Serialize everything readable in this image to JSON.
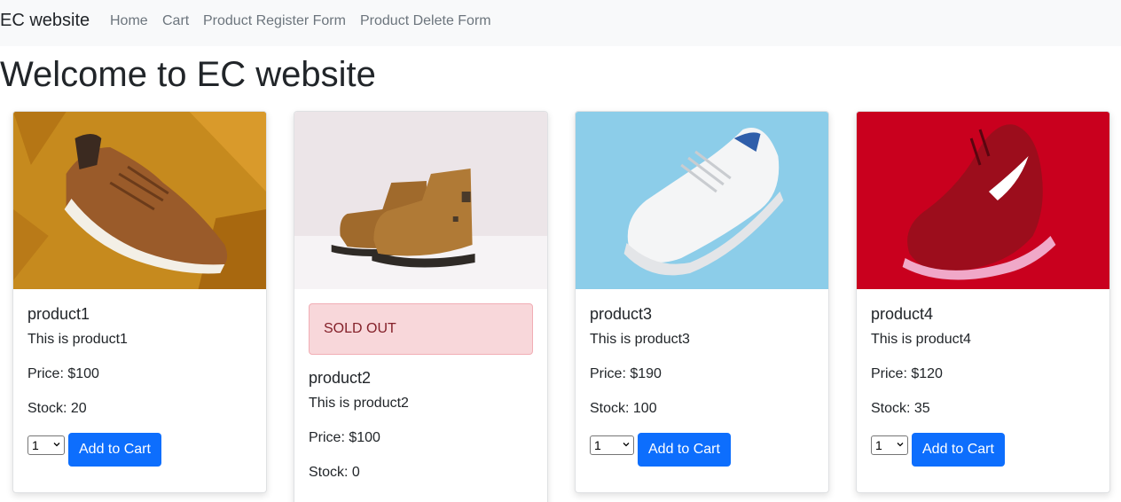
{
  "nav": {
    "brand": "EC website",
    "links": [
      "Home",
      "Cart",
      "Product Register Form",
      "Product Delete Form"
    ]
  },
  "page": {
    "title": "Welcome to EC website"
  },
  "labels": {
    "add_to_cart": "Add to Cart",
    "sold_out": "SOLD OUT"
  },
  "products": [
    {
      "name": "product1",
      "description": "This is product1",
      "price": "Price: $100",
      "stock": "Stock: 20",
      "qty": "1",
      "sold_out": false,
      "image": "brown sneaker on mustard fabric"
    },
    {
      "name": "product2",
      "description": "This is product2",
      "price": "Price: $100",
      "stock": "Stock: 0",
      "qty": "1",
      "sold_out": true,
      "image": "brown leather boots"
    },
    {
      "name": "product3",
      "description": "This is product3",
      "price": "Price: $190",
      "stock": "Stock: 100",
      "qty": "1",
      "sold_out": false,
      "image": "white running shoe on light blue"
    },
    {
      "name": "product4",
      "description": "This is product4",
      "price": "Price: $120",
      "stock": "Stock: 35",
      "qty": "1",
      "sold_out": false,
      "image": "red running shoe on red"
    }
  ],
  "colors": {
    "navbar_bg": "#f8f9fa",
    "primary_button": "#0d6efd",
    "sold_out_bg": "#f8d7da",
    "sold_out_text": "#842029"
  }
}
